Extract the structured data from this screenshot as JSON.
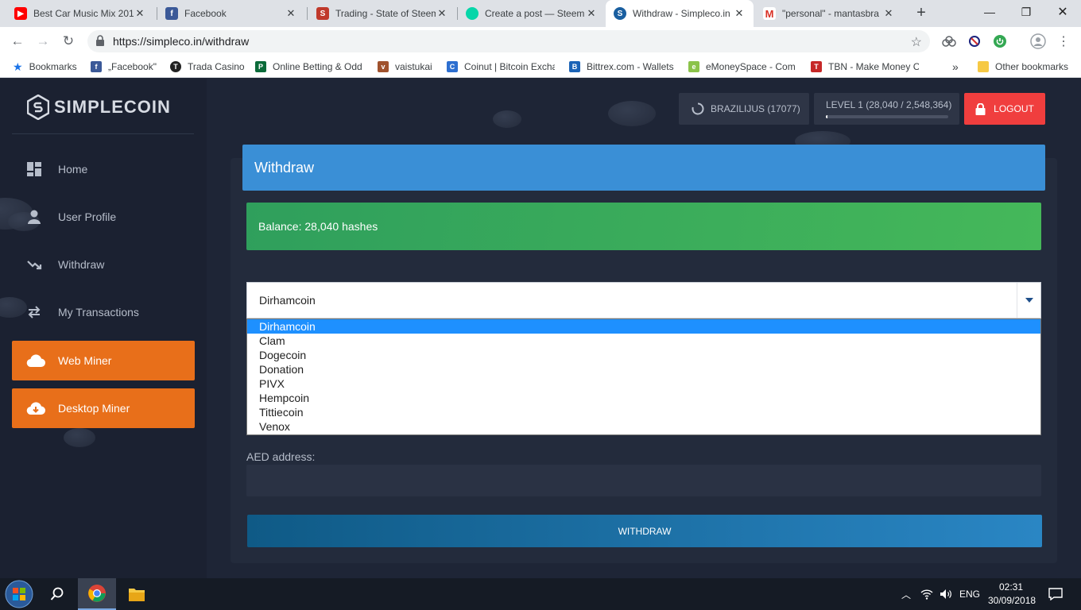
{
  "browser": {
    "tabs": [
      {
        "title": "Best Car Music Mix 201",
        "icon": "youtube-icon",
        "color": "#ff0000"
      },
      {
        "title": "Facebook",
        "icon": "facebook-icon",
        "color": "#3b5998"
      },
      {
        "title": "Trading - State of Steem",
        "icon": "steem-icon",
        "color": "#c0392b"
      },
      {
        "title": "Create a post — Steem",
        "icon": "steemit-icon",
        "color": "#06d6a9"
      },
      {
        "title": "Withdraw - Simpleco.in",
        "icon": "simplecoin-icon",
        "color": "#1a5fa0"
      },
      {
        "title": "\"personal\" - mantasbra",
        "icon": "gmail-icon",
        "color": "#d93025"
      }
    ],
    "url": "https://simpleco.in/withdraw",
    "bookmarks": [
      {
        "label": "Bookmarks",
        "icon": "star-icon",
        "color": "#1a73e8"
      },
      {
        "label": "„Facebook\"",
        "icon": "facebook-icon",
        "color": "#3b5998"
      },
      {
        "label": "Trada Casino",
        "icon": "trada-icon",
        "color": "#222222"
      },
      {
        "label": "Online Betting & Odd",
        "icon": "paddypower-icon",
        "color": "#0b6b3a"
      },
      {
        "label": "vaistukai",
        "icon": "vaistukai-icon",
        "color": "#a0522d"
      },
      {
        "label": "Coinut | Bitcoin Excha",
        "icon": "coinut-icon",
        "color": "#2d6fd0"
      },
      {
        "label": "Bittrex.com - Wallets",
        "icon": "bittrex-icon",
        "color": "#1b63b6"
      },
      {
        "label": "eMoneySpace - Com",
        "icon": "emoneyspace-icon",
        "color": "#8bc34a"
      },
      {
        "label": "TBN - Make Money C",
        "icon": "tbn-icon",
        "color": "#c62828"
      }
    ],
    "bookmarks_overflow": "»",
    "other_bookmarks": "Other bookmarks"
  },
  "sidebar": {
    "logo": "SIMPLECOIN",
    "items": [
      {
        "label": "Home",
        "icon": "dashboard-icon"
      },
      {
        "label": "User Profile",
        "icon": "user-icon"
      },
      {
        "label": "Withdraw",
        "icon": "trend-down-icon"
      },
      {
        "label": "My Transactions",
        "icon": "exchange-icon"
      },
      {
        "label": "Web Miner",
        "icon": "cloud-icon"
      },
      {
        "label": "Desktop Miner",
        "icon": "cloud-download-icon"
      }
    ]
  },
  "header": {
    "user": "BRAZILIJUS (17077)",
    "level": "LEVEL 1 (28,040 / 2,548,364)",
    "level_progress": 0.011,
    "logout": "LOGOUT"
  },
  "withdraw": {
    "title": "Withdraw",
    "balance": "Balance: 28,040 hashes",
    "selected_coin": "Dirhamcoin",
    "options": [
      "Dirhamcoin",
      "Clam",
      "Dogecoin",
      "Donation",
      "PIVX",
      "Hempcoin",
      "Tittiecoin",
      "Venox"
    ],
    "address_label": "AED address:",
    "address_value": "",
    "button": "WITHDRAW"
  },
  "taskbar": {
    "language": "ENG",
    "time": "02:31",
    "date": "30/09/2018"
  },
  "colors": {
    "accent_blue": "#3a8fd6",
    "balance_green": "#3aad5b",
    "miner_orange": "#e86f1a",
    "logout_red": "#f03e3e"
  }
}
